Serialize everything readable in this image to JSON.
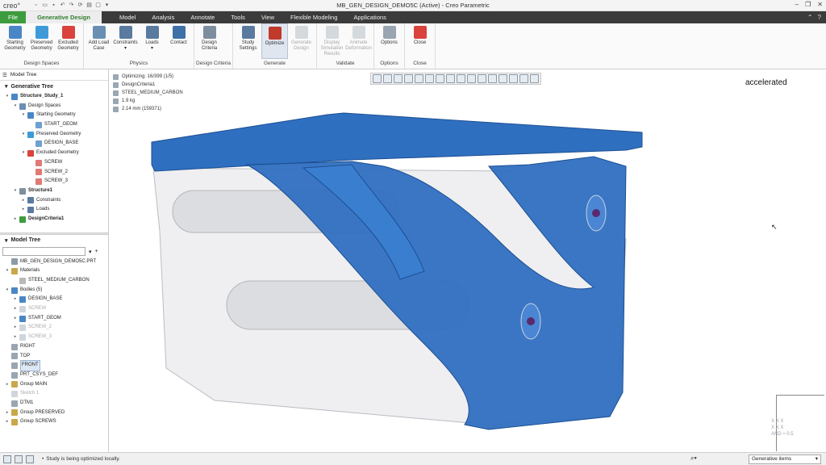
{
  "app": {
    "logo": "creo°",
    "title": "MB_GEN_DESIGN_DEMO5C (Active) - Creo Parametric"
  },
  "menu": {
    "file": "File",
    "tabs": [
      "Generative Design",
      "Model",
      "Analysis",
      "Annotate",
      "Tools",
      "View",
      "Flexible Modeling",
      "Applications"
    ]
  },
  "ribbon": {
    "groups": [
      {
        "label": "Design Spaces",
        "buttons": [
          {
            "label": "Starting\nGeometry",
            "color": "#4a86c5"
          },
          {
            "label": "Preserved\nGeometry",
            "color": "#3e9bd8"
          },
          {
            "label": "Excluded\nGeometry",
            "color": "#d9433c"
          }
        ]
      },
      {
        "label": "Physics",
        "buttons": [
          {
            "label": "Add Load\nCase",
            "color": "#6b8fb3"
          },
          {
            "label": "Constraints\n▾",
            "color": "#5a7aa0"
          },
          {
            "label": "Loads\n▾",
            "color": "#5a7aa0"
          },
          {
            "label": "Contact",
            "color": "#3f70a8"
          }
        ]
      },
      {
        "label": "Design Criteria",
        "buttons": [
          {
            "label": "Design\nCriteria",
            "color": "#7d8e9f"
          }
        ]
      },
      {
        "label": "Generate",
        "buttons": [
          {
            "label": "Study\nSettings",
            "color": "#5a7aa0"
          },
          {
            "label": "Optimize",
            "color": "#c0392b",
            "pressed": true
          },
          {
            "label": "Generate\nDesign",
            "color": "#8d9aa6",
            "disabled": true
          }
        ]
      },
      {
        "label": "Validate",
        "buttons": [
          {
            "label": "Display\nSimulation Results",
            "color": "#8d9aa6",
            "disabled": true
          },
          {
            "label": "Animate\nDeformation",
            "color": "#8d9aa6",
            "disabled": true
          }
        ]
      },
      {
        "label": "Options",
        "buttons": [
          {
            "label": "Options",
            "color": "#9aa5b1"
          }
        ]
      },
      {
        "label": "Close",
        "buttons": [
          {
            "label": "Close",
            "color": "#d9433c"
          }
        ]
      }
    ]
  },
  "left_panel": {
    "tab_label": "Model Tree",
    "gen_tree_title": "Generative Tree",
    "gen_tree": [
      {
        "label": "Structure_Study_1",
        "indent": 0,
        "bold": true,
        "toggle": "▾",
        "color": "#4a86c5"
      },
      {
        "label": "Design Spaces",
        "indent": 1,
        "toggle": "▾",
        "color": "#6b8fb3"
      },
      {
        "label": "Starting Geometry",
        "indent": 2,
        "toggle": "▾",
        "color": "#4a86c5"
      },
      {
        "label": "START_GEOM",
        "indent": 3,
        "toggle": "",
        "color": "#6fa0d0"
      },
      {
        "label": "Preserved Geometry",
        "indent": 2,
        "toggle": "▾",
        "color": "#3e9bd8"
      },
      {
        "label": "DESIGN_BASE",
        "indent": 3,
        "toggle": "",
        "color": "#6fa0d0"
      },
      {
        "label": "Excluded Geometry",
        "indent": 2,
        "toggle": "▾",
        "color": "#d9433c"
      },
      {
        "label": "SCREW",
        "indent": 3,
        "toggle": "",
        "color": "#e07a74"
      },
      {
        "label": "SCREW_2",
        "indent": 3,
        "toggle": "",
        "color": "#e07a74"
      },
      {
        "label": "SCREW_3",
        "indent": 3,
        "toggle": "",
        "color": "#e07a74"
      },
      {
        "label": "Structure1",
        "indent": 1,
        "bold": true,
        "toggle": "▾",
        "color": "#7d8e9f"
      },
      {
        "label": "Constraints",
        "indent": 2,
        "toggle": "▸",
        "color": "#5a7aa0"
      },
      {
        "label": "Loads",
        "indent": 2,
        "toggle": "▸",
        "color": "#5a7aa0"
      },
      {
        "label": "DesignCriteria1",
        "indent": 1,
        "bold": true,
        "toggle": "▸",
        "color": "#3d9c3d"
      }
    ],
    "model_tree_title": "Model Tree",
    "model_tree": [
      {
        "label": "MB_GEN_DESIGN_DEMO5C.PRT",
        "indent": 0,
        "toggle": "",
        "color": "#8d9aa6"
      },
      {
        "label": "Materials",
        "indent": 0,
        "toggle": "▾",
        "color": "#c9a74a"
      },
      {
        "label": "STEEL_MEDIUM_CARBON",
        "indent": 1,
        "toggle": "",
        "color": "#b9b9b9"
      },
      {
        "label": "Bodies (5)",
        "indent": 0,
        "toggle": "▾",
        "color": "#4a86c5"
      },
      {
        "label": "DESIGN_BASE",
        "indent": 1,
        "toggle": "▸",
        "color": "#4a86c5"
      },
      {
        "label": "SCREW",
        "indent": 1,
        "toggle": "▸",
        "color": "#cfd6dd",
        "dim": true
      },
      {
        "label": "START_GEOM",
        "indent": 1,
        "toggle": "▸",
        "color": "#4a86c5"
      },
      {
        "label": "SCREW_2",
        "indent": 1,
        "toggle": "▸",
        "color": "#cfd6dd",
        "dim": true
      },
      {
        "label": "SCREW_3",
        "indent": 1,
        "toggle": "▸",
        "color": "#cfd6dd",
        "dim": true
      },
      {
        "label": "RIGHT",
        "indent": 0,
        "toggle": "",
        "color": "#9aa5b1"
      },
      {
        "label": "TOP",
        "indent": 0,
        "toggle": "",
        "color": "#9aa5b1"
      },
      {
        "label": "FRONT",
        "indent": 0,
        "toggle": "",
        "color": "#9aa5b1",
        "selected": true
      },
      {
        "label": "PRT_CSYS_DEF",
        "indent": 0,
        "toggle": "",
        "color": "#9aa5b1"
      },
      {
        "label": "Group MAIN",
        "indent": 0,
        "toggle": "▸",
        "color": "#c9a74a"
      },
      {
        "label": "Sketch 1",
        "indent": 0,
        "toggle": "",
        "color": "#cfd6dd",
        "dim": true
      },
      {
        "label": "DTM1",
        "indent": 0,
        "toggle": "",
        "color": "#9aa5b1"
      },
      {
        "label": "Group PRESERVED",
        "indent": 0,
        "toggle": "▸",
        "color": "#c9a74a"
      },
      {
        "label": "Group SCREWS",
        "indent": 0,
        "toggle": "▸",
        "color": "#c9a74a"
      }
    ]
  },
  "viewport": {
    "status_lines": [
      "Optimizing: 16/399 (1/5)",
      "DesignCriteria1",
      "STEEL_MEDIUM_CARBON",
      "1.9 kg",
      "2.14 mm (159371)"
    ],
    "overlay": "accelerated"
  },
  "statusbar": {
    "message": "Study is being optimized locally.",
    "filter": "Generative items"
  },
  "colors": {
    "part_blue": "#2f6fc0",
    "accent_green": "#3d9c3d"
  }
}
